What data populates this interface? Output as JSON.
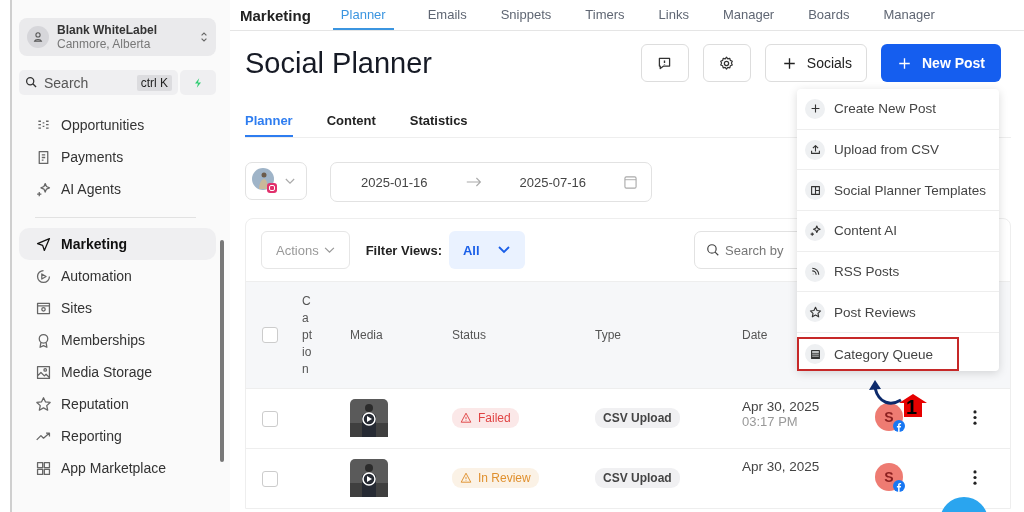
{
  "section_title": "Marketing",
  "top_nav": [
    {
      "label": "Planner",
      "selected": true
    },
    {
      "label": "Emails",
      "selected": false
    },
    {
      "label": "Snippets",
      "selected": false
    },
    {
      "label": "Timers",
      "selected": false
    },
    {
      "label": "Links",
      "selected": false
    },
    {
      "label": "Manager",
      "selected": false
    },
    {
      "label": "Boards",
      "selected": false
    },
    {
      "label": "Manager",
      "selected": false
    }
  ],
  "sidebar": {
    "account": {
      "name": "Blank WhiteLabel",
      "location": "Canmore, Alberta"
    },
    "search": {
      "placeholder": "Search",
      "shortcut": "ctrl K"
    },
    "groups": [
      [
        {
          "label": "Opportunities",
          "selected": false
        },
        {
          "label": "Payments",
          "selected": false
        },
        {
          "label": "AI Agents",
          "selected": false
        }
      ],
      [
        {
          "label": "Marketing",
          "selected": true
        },
        {
          "label": "Automation",
          "selected": false
        },
        {
          "label": "Sites",
          "selected": false
        },
        {
          "label": "Memberships",
          "selected": false
        },
        {
          "label": "Media Storage",
          "selected": false
        },
        {
          "label": "Reputation",
          "selected": false
        },
        {
          "label": "Reporting",
          "selected": false
        },
        {
          "label": "App Marketplace",
          "selected": false
        }
      ]
    ]
  },
  "page": {
    "title": "Social Planner",
    "socials_button": "Socials",
    "new_post_button": "New Post",
    "tabs": [
      {
        "label": "Planner",
        "selected": true
      },
      {
        "label": "Content",
        "selected": false
      },
      {
        "label": "Statistics",
        "selected": false
      }
    ],
    "date_from": "2025-01-16",
    "date_to": "2025-07-16",
    "actions": "Actions",
    "filter_label": "Filter Views:",
    "filter_value": "All",
    "search_placeholder": "Search by",
    "select_all_checked": false,
    "columns": [
      "C a pt io n",
      "Media",
      "Status",
      "Type",
      "Date"
    ],
    "rows": [
      {
        "checked": false,
        "status": "Failed",
        "color": "#e04444",
        "type": "CSV Upload",
        "date": "Apr 30, 2025",
        "time": "03:17 PM",
        "avatar": "S"
      },
      {
        "checked": false,
        "status": "In Review",
        "color": "#e0902e",
        "type": "CSV Upload",
        "date": "Apr 30, 2025",
        "time": "",
        "avatar": "S"
      }
    ]
  },
  "menu": [
    {
      "label": "Create New Post",
      "highlighted": false
    },
    {
      "label": "Upload from CSV",
      "highlighted": false
    },
    {
      "label": "Social Planner Templates",
      "highlighted": false
    },
    {
      "label": "Content AI",
      "highlighted": false
    },
    {
      "label": "RSS Posts",
      "highlighted": false
    },
    {
      "label": "Post Reviews",
      "highlighted": false
    },
    {
      "label": "Category Queue",
      "highlighted": true
    }
  ],
  "callout": {
    "number": "1"
  }
}
